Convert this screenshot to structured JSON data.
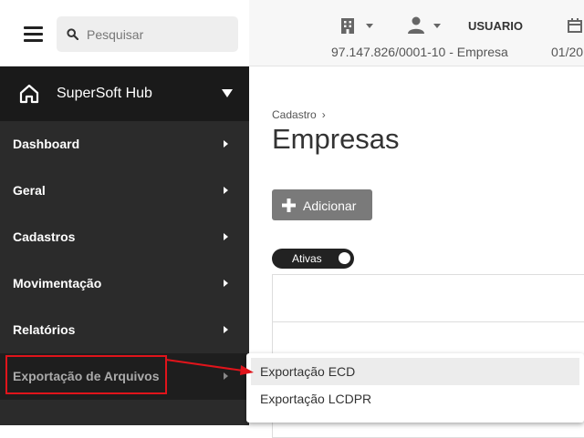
{
  "search": {
    "placeholder": "Pesquisar"
  },
  "brand": {
    "name": "SuperSoft Hub"
  },
  "sidebar": {
    "items": [
      {
        "label": "Dashboard"
      },
      {
        "label": "Geral"
      },
      {
        "label": "Cadastros"
      },
      {
        "label": "Movimentação"
      },
      {
        "label": "Relatórios"
      },
      {
        "label": "Exportação de Arquivos"
      }
    ]
  },
  "header": {
    "user_label": "USUARIO",
    "company": "97.147.826/0001-10 - Empresa",
    "date_partial": "01/20"
  },
  "main": {
    "breadcrumb": "Cadastro",
    "breadcrumb_sep": "›",
    "title": "Empresas",
    "add_label": "Adicionar",
    "toggle_label": "Ativas"
  },
  "submenu": {
    "items": [
      {
        "label": "Exportação ECD"
      },
      {
        "label": "Exportação LCDPR"
      }
    ]
  },
  "icons": {
    "menu": "hamburger-icon",
    "search": "search-icon",
    "home": "home-icon",
    "building": "building-icon",
    "user": "person-icon",
    "calendar": "calendar-icon",
    "add": "plus-icon"
  },
  "colors": {
    "sidebar_bg": "#2b2b2b",
    "brand_bg": "#1a1a1a",
    "highlight": "#e0141b",
    "button_bg": "#7a7a7a",
    "toggle_bg": "#222222"
  }
}
